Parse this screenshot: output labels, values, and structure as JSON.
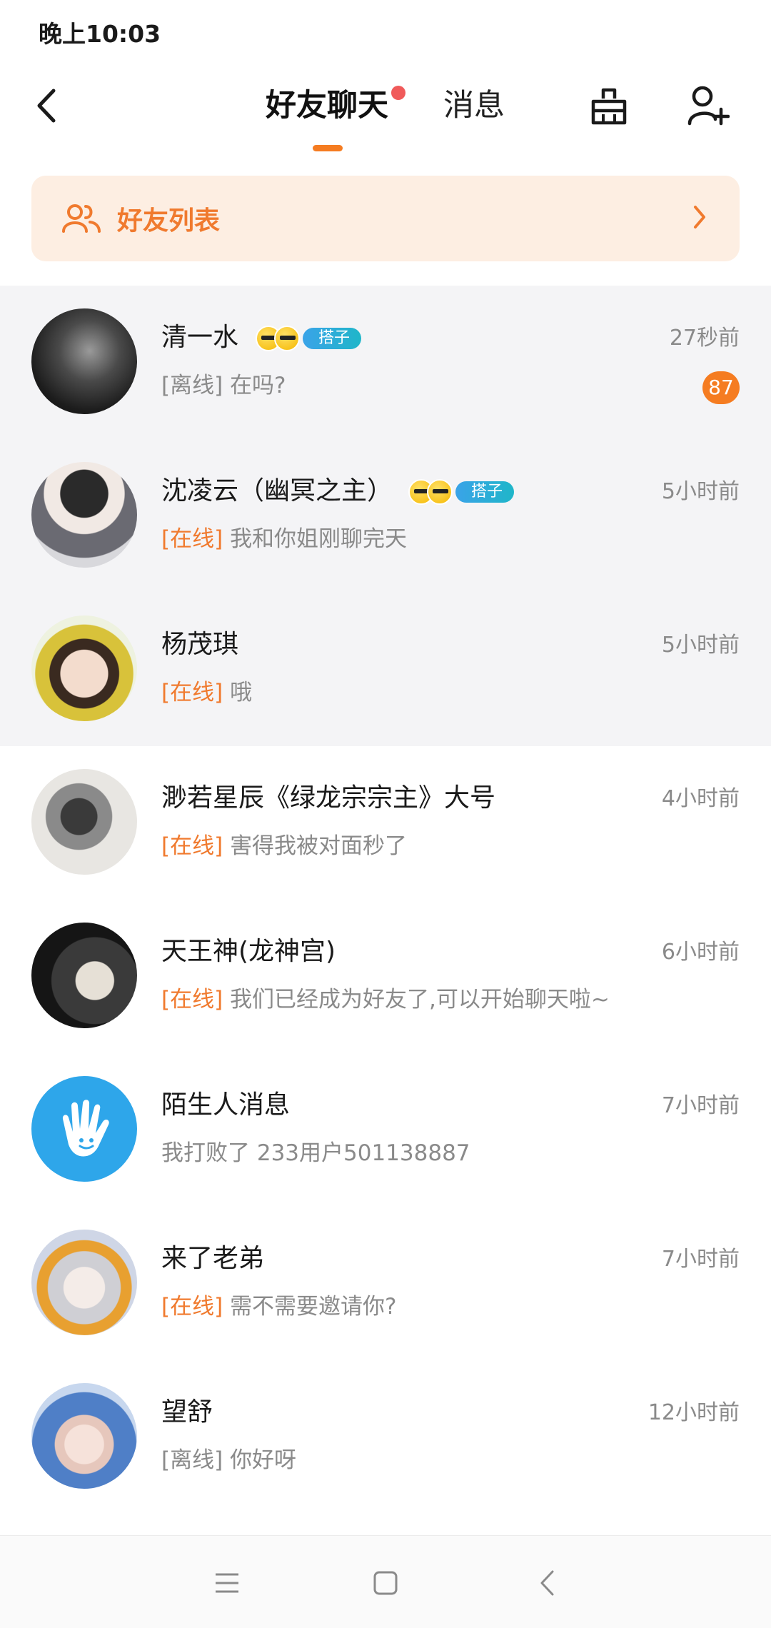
{
  "status_bar": {
    "time": "晚上10:03"
  },
  "header": {
    "tabs": [
      {
        "label": "好友聊天",
        "active": true,
        "has_dot": true
      },
      {
        "label": "消息",
        "active": false
      }
    ],
    "icons": [
      "back-arrow-icon",
      "clean-basket-icon",
      "add-friend-icon"
    ]
  },
  "friend_list": {
    "label": "好友列表"
  },
  "chats": [
    {
      "name": "清一水",
      "time": "27秒前",
      "status": "[离线]",
      "online": false,
      "message": "在吗?",
      "unread": "87",
      "tag": "搭子"
    },
    {
      "name": "沈凌云（幽冥之主）",
      "time": "5小时前",
      "status": "[在线]",
      "online": true,
      "message": "我和你姐刚聊完天",
      "tag": "搭子"
    },
    {
      "name": "杨茂琪",
      "time": "5小时前",
      "status": "[在线]",
      "online": true,
      "message": "哦"
    },
    {
      "name": "渺若星辰《绿龙宗宗主》大号",
      "time": "4小时前",
      "status": "[在线]",
      "online": true,
      "message": "害得我被对面秒了"
    },
    {
      "name": "天王神(龙神宫)",
      "time": "6小时前",
      "status": "[在线]",
      "online": true,
      "message": "我们已经成为好友了,可以开始聊天啦~"
    },
    {
      "name": "陌生人消息",
      "time": "7小时前",
      "status": "",
      "online": false,
      "message": "我打败了 233用户501138887"
    },
    {
      "name": "来了老弟",
      "time": "7小时前",
      "status": "[在线]",
      "online": true,
      "message": "需不需要邀请你?"
    },
    {
      "name": "望舒",
      "time": "12小时前",
      "status": "[离线]",
      "online": false,
      "message": "你好呀"
    }
  ],
  "colors": {
    "accent": "#f57c21",
    "banner_bg": "#fdeee2",
    "online": "#f07a2e",
    "muted": "#8a8a8a"
  }
}
